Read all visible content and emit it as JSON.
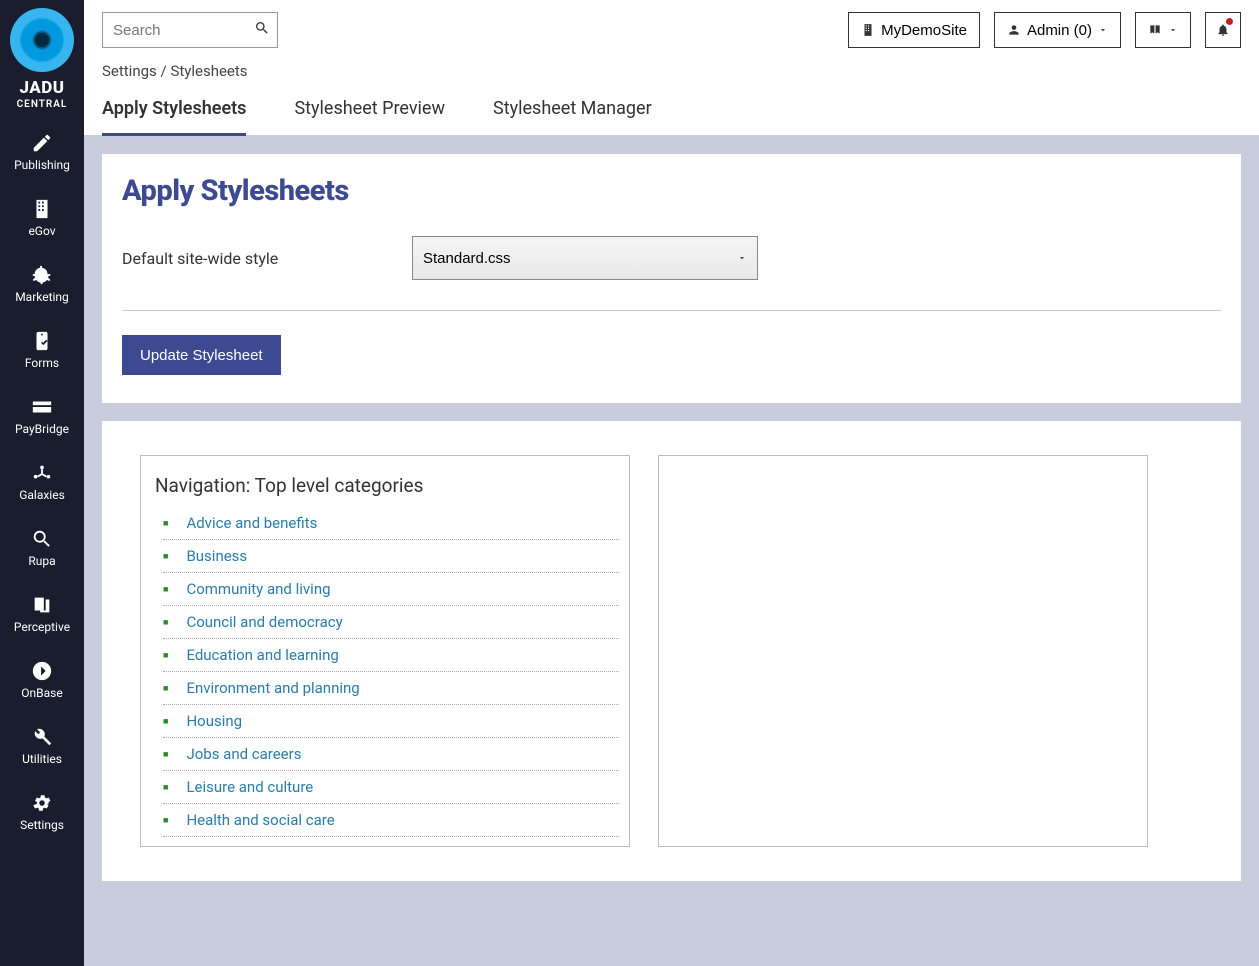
{
  "brand": {
    "name": "JADU",
    "sub": "CENTRAL"
  },
  "sidebar": {
    "items": [
      {
        "label": "Publishing",
        "icon": "pencil"
      },
      {
        "label": "eGov",
        "icon": "building"
      },
      {
        "label": "Marketing",
        "icon": "bullhorn"
      },
      {
        "label": "Forms",
        "icon": "clipboard"
      },
      {
        "label": "PayBridge",
        "icon": "card"
      },
      {
        "label": "Galaxies",
        "icon": "network"
      },
      {
        "label": "Rupa",
        "icon": "magnifier"
      },
      {
        "label": "Perceptive",
        "icon": "docs"
      },
      {
        "label": "OnBase",
        "icon": "circle-arrow"
      },
      {
        "label": "Utilities",
        "icon": "wrench"
      },
      {
        "label": "Settings",
        "icon": "gear"
      }
    ]
  },
  "topbar": {
    "search_placeholder": "Search",
    "site_button": "MyDemoSite",
    "user_button": "Admin (0)"
  },
  "breadcrumb": {
    "root": "Settings",
    "current": "Stylesheets"
  },
  "tabs": [
    {
      "label": "Apply Stylesheets",
      "active": true
    },
    {
      "label": "Stylesheet Preview",
      "active": false
    },
    {
      "label": "Stylesheet Manager",
      "active": false
    }
  ],
  "form": {
    "title": "Apply Stylesheets",
    "default_style_label": "Default site-wide style",
    "default_style_value": "Standard.css",
    "update_button": "Update Stylesheet"
  },
  "preview": {
    "nav_title": "Navigation: Top level categories",
    "categories": [
      "Advice and benefits",
      "Business",
      "Community and living",
      "Council and democracy",
      "Education and learning",
      "Environment and planning",
      "Housing",
      "Jobs and careers",
      "Leisure and culture",
      "Health and social care"
    ]
  }
}
